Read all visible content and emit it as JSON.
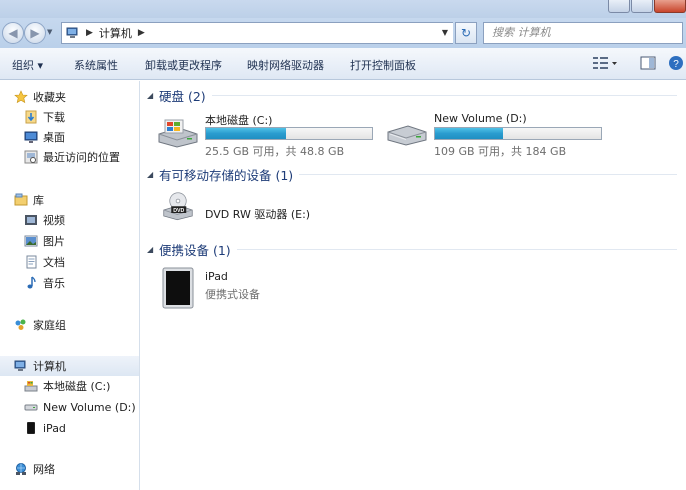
{
  "window": {
    "title": "计算机"
  },
  "address": {
    "breadcrumb": "计算机"
  },
  "search": {
    "placeholder": "搜索 计算机"
  },
  "toolbar": {
    "organize": "组织 ▾",
    "items": [
      "系统属性",
      "卸载或更改程序",
      "映射网络驱动器",
      "打开控制面板"
    ]
  },
  "sidebar": {
    "favorites": {
      "header": "收藏夹",
      "items": [
        "下载",
        "桌面",
        "最近访问的位置"
      ]
    },
    "libraries": {
      "header": "库",
      "items": [
        "视频",
        "图片",
        "文档",
        "音乐"
      ]
    },
    "homegroup": "家庭组",
    "computer": {
      "header": "计算机",
      "items": [
        "本地磁盘 (C:)",
        "New Volume (D:)",
        "iPad"
      ]
    },
    "network": "网络"
  },
  "main": {
    "groups": [
      {
        "title": "硬盘 (2)"
      },
      {
        "title": "有可移动存储的设备 (1)"
      },
      {
        "title": "便携设备 (1)"
      }
    ],
    "drives": [
      {
        "name": "本地磁盘 (C:)",
        "free_text": "25.5 GB 可用，共 48.8 GB",
        "used_fraction": 0.48
      },
      {
        "name": "New Volume (D:)",
        "free_text": "109 GB 可用，共 184 GB",
        "used_fraction": 0.41
      }
    ],
    "removable": {
      "name": "DVD RW 驱动器 (E:)",
      "icon_label": "DVD"
    },
    "portable": {
      "name": "iPad",
      "subtitle": "便携式设备"
    }
  },
  "colors": {
    "group_title": "#1e3c78",
    "bar_fill": "#2a9ccf",
    "selection": "#dde7f3"
  }
}
